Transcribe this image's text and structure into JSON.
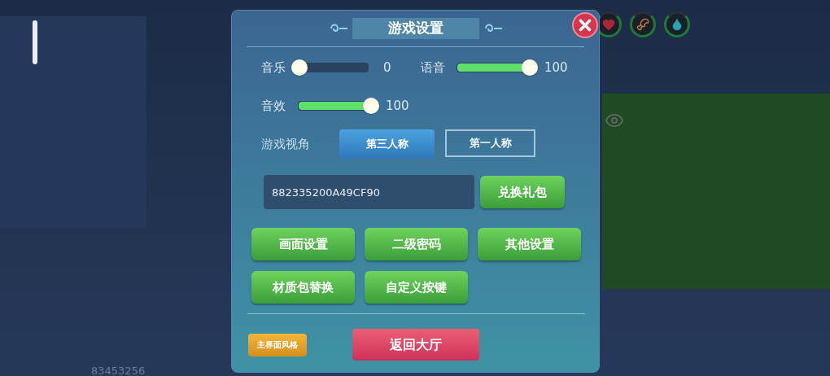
{
  "dialog": {
    "title": "游戏设置"
  },
  "sliders": [
    {
      "label": "音乐",
      "level": 0,
      "reading": "0"
    },
    {
      "label": "语音",
      "level": 1,
      "reading": "100"
    },
    {
      "label": "音效",
      "level": 1,
      "reading": "100"
    }
  ],
  "camera": {
    "label": "游戏视角",
    "options": [
      {
        "label": "第三人称",
        "selected": true
      },
      {
        "label": "第一人称",
        "selected": false
      }
    ]
  },
  "gift_code": {
    "value": "882335200A49CF90",
    "button": "兑换礼包"
  },
  "menu_buttons": [
    "画面设置",
    "二级密码",
    "其他设置",
    "材质包替换",
    "自定义按键"
  ],
  "footer": {
    "style_button": "主界面风格",
    "back_button": "返回大厅"
  },
  "overlay_text": "83453256"
}
